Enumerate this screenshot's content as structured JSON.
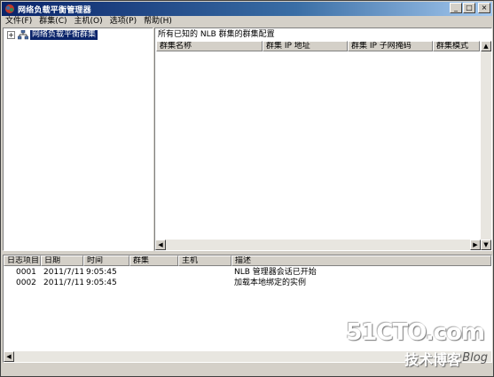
{
  "window": {
    "title": "网络负载平衡管理器",
    "buttons": {
      "minimize": "_",
      "maximize": "□",
      "close": "×"
    }
  },
  "menu": [
    {
      "label": "文件(F)"
    },
    {
      "label": "群集(C)"
    },
    {
      "label": "主机(O)"
    },
    {
      "label": "选项(P)"
    },
    {
      "label": "帮助(H)"
    }
  ],
  "tree": {
    "expander": "+",
    "root_label": "网络负载平衡群集",
    "icon": "cluster-icon"
  },
  "cluster_panel": {
    "caption": "所有已知的 NLB 群集的群集配置",
    "columns": [
      "群集名称",
      "群集 IP 地址",
      "群集 IP 子网掩码",
      "群集模式"
    ]
  },
  "log": {
    "columns": [
      "日志项目 #",
      "日期",
      "时间",
      "群集",
      "主机",
      "描述"
    ],
    "rows": [
      {
        "id": "0001",
        "date": "2011/7/11",
        "time": "9:05:45",
        "cluster": "",
        "host": "",
        "desc": "NLB 管理器会话已开始"
      },
      {
        "id": "0002",
        "date": "2011/7/11",
        "time": "9:05:45",
        "cluster": "",
        "host": "",
        "desc": "加载本地绑定的实例"
      }
    ]
  },
  "watermark": {
    "brand": "51CTO.com",
    "sub": "技术博客",
    "blog": "Blog"
  },
  "colors": {
    "title_bar": "#0a246a",
    "selection": "#0a246a",
    "face": "#d4d0c8"
  }
}
